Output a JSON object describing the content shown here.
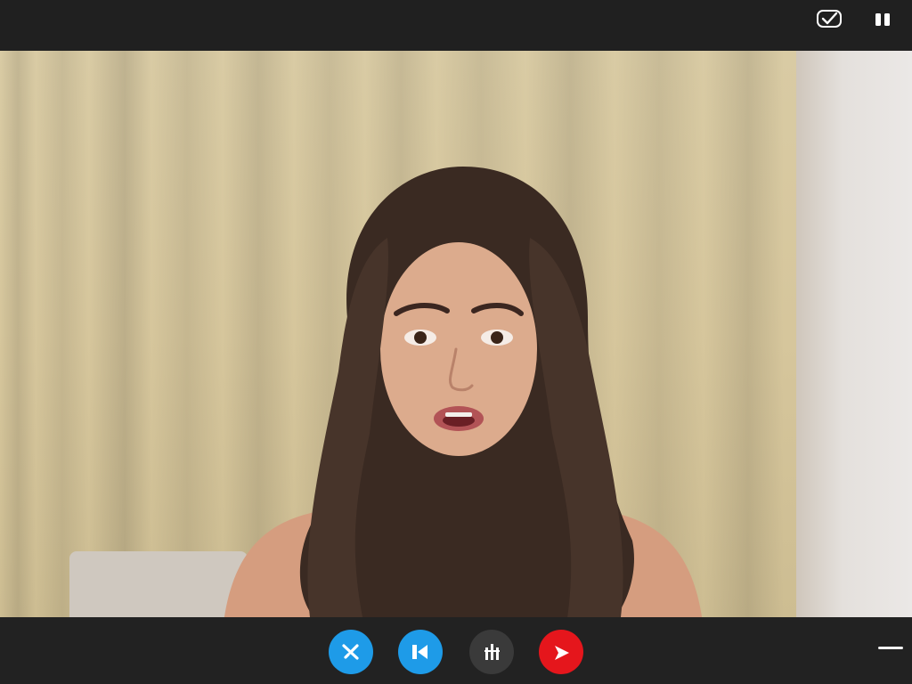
{
  "app": {
    "type": "video-call"
  },
  "top_bar": {
    "icons": [
      {
        "name": "chat-check-icon"
      },
      {
        "name": "pause-icon"
      }
    ]
  },
  "video": {
    "subject": "participant-video"
  },
  "controls": [
    {
      "name": "mute-button",
      "icon": "mic-off-icon",
      "color": "#1e9be8"
    },
    {
      "name": "camera-button",
      "icon": "video-icon",
      "color": "#1e9be8"
    },
    {
      "name": "effects-button",
      "icon": "bars-icon",
      "color": "#3a3a3a"
    },
    {
      "name": "end-call-button",
      "icon": "end-call-icon",
      "color": "#e5161c"
    }
  ],
  "window": {
    "minimize_icon": "minimize-icon"
  }
}
